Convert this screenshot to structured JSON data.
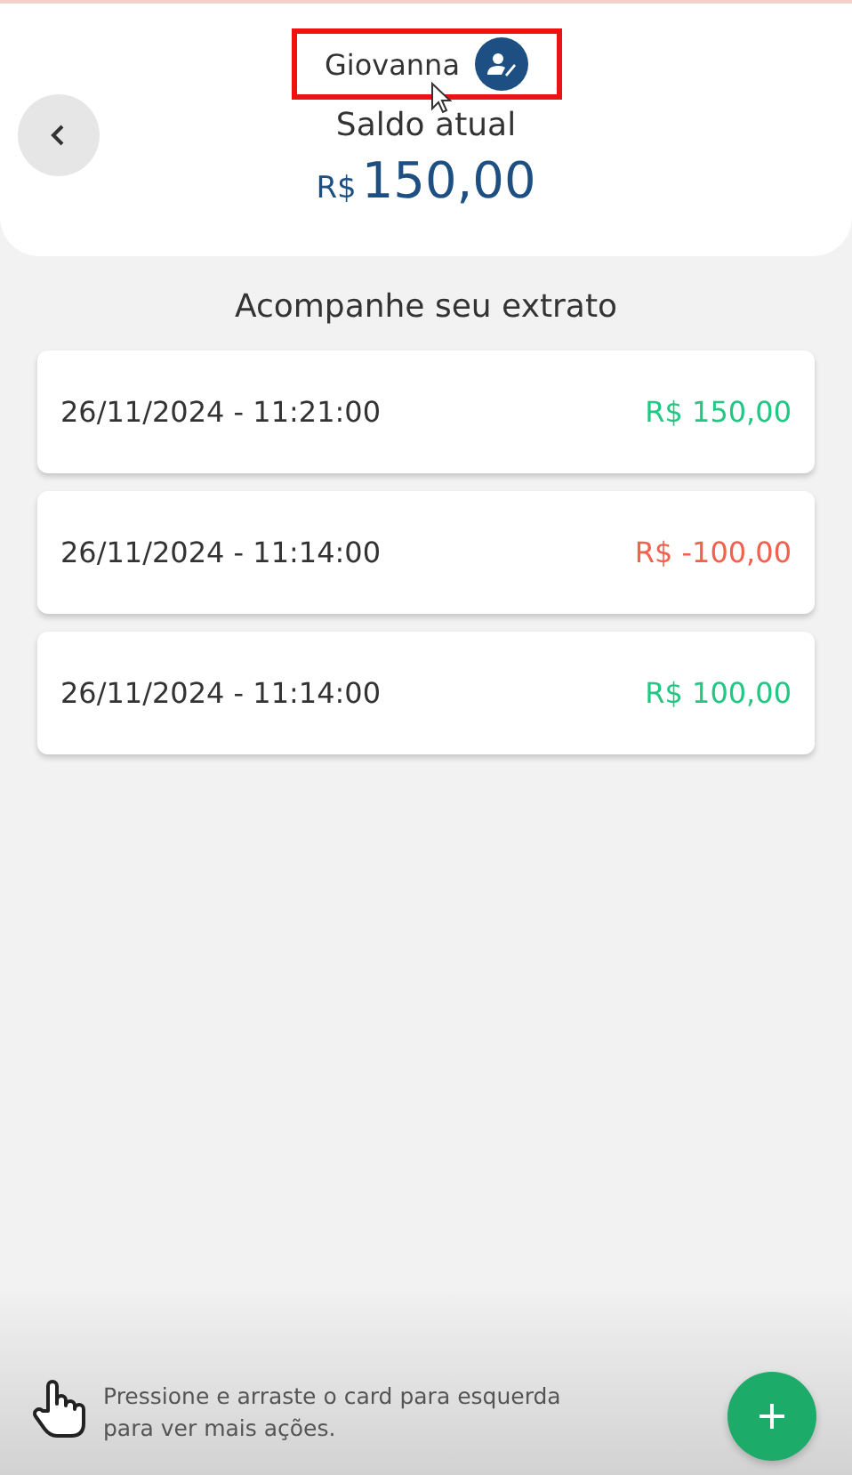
{
  "header": {
    "user_name": "Giovanna",
    "highlighted": true,
    "balance_label": "Saldo atual",
    "currency": "R$",
    "balance": "150,00"
  },
  "section_title": "Acompanhe seu extrato",
  "transactions": [
    {
      "datetime": "26/11/2024 - 11:21:00",
      "amount": "R$ 150,00",
      "kind": "credit"
    },
    {
      "datetime": "26/11/2024 - 11:14:00",
      "amount": "R$ -100,00",
      "kind": "debit"
    },
    {
      "datetime": "26/11/2024 - 11:14:00",
      "amount": "R$ 100,00",
      "kind": "credit"
    }
  ],
  "footer": {
    "hint": "Pressione e arraste o card para esquerda para ver mais ações."
  }
}
